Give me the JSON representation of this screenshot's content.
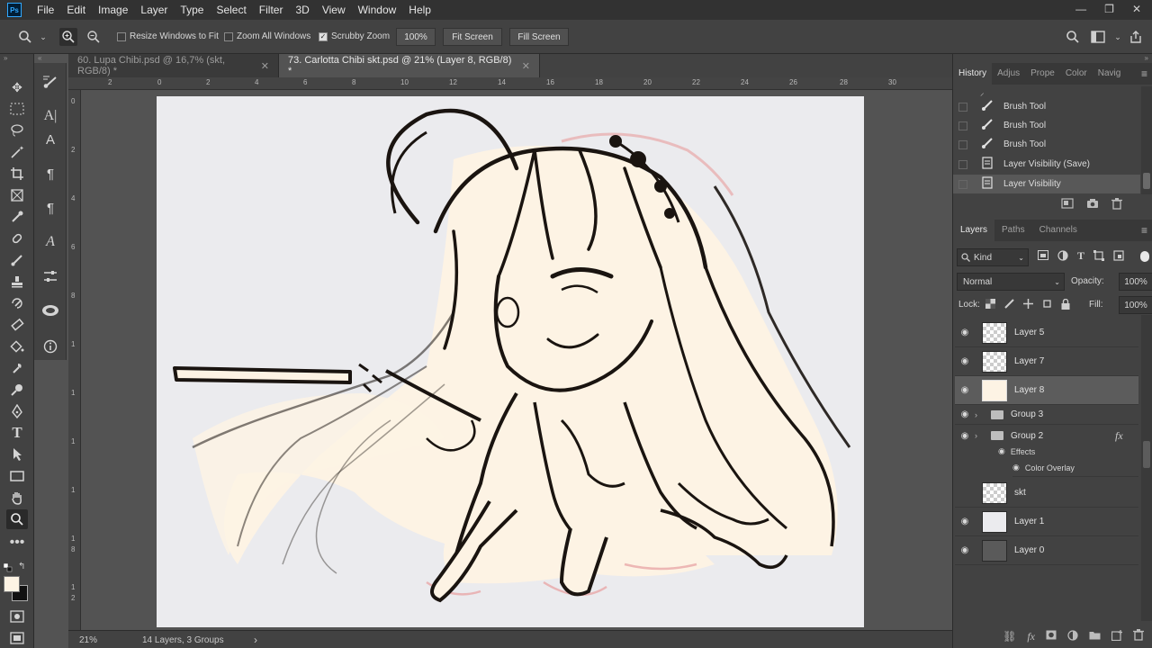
{
  "menubar": {
    "logo": "Ps",
    "items": [
      "File",
      "Edit",
      "Image",
      "Layer",
      "Type",
      "Select",
      "Filter",
      "3D",
      "View",
      "Window",
      "Help"
    ],
    "window_controls": [
      "—",
      "❐",
      "✕"
    ]
  },
  "options": {
    "resize_windows": "Resize Windows to Fit",
    "zoom_all": "Zoom All Windows",
    "scrubby_zoom": "Scrubby Zoom",
    "zoom_value": "100%",
    "fit_screen": "Fit Screen",
    "fill_screen": "Fill Screen"
  },
  "tabs": [
    {
      "label": "60. Lupa Chibi.psd @ 16,7% (skt, RGB/8) *"
    },
    {
      "label": "73. Carlotta Chibi skt.psd @ 21% (Layer 8, RGB/8) *"
    }
  ],
  "ruler_top": [
    "2",
    "0",
    "2",
    "4",
    "6",
    "8",
    "10",
    "12",
    "14",
    "16",
    "18",
    "20",
    "22",
    "24",
    "26",
    "28",
    "30"
  ],
  "ruler_left": [
    "0",
    "2",
    "4",
    "6",
    "8",
    "1",
    "1",
    "1",
    "1",
    "1",
    "8",
    "1",
    "2"
  ],
  "status": {
    "zoom": "21%",
    "info": "14 Layers, 3 Groups"
  },
  "history": {
    "tabs": [
      "History",
      "Adjus",
      "Prope",
      "Color",
      "Navig"
    ],
    "items": [
      {
        "label": "Brush Tool",
        "icon": "brush-icon"
      },
      {
        "label": "Brush Tool",
        "icon": "brush-icon"
      },
      {
        "label": "Brush Tool",
        "icon": "brush-icon"
      },
      {
        "label": "Layer Visibility (Save)",
        "icon": "document-icon"
      },
      {
        "label": "Layer Visibility",
        "icon": "document-icon"
      }
    ]
  },
  "layers_panel": {
    "tabs": [
      "Layers",
      "Paths",
      "Channels"
    ],
    "filter": "Kind",
    "blend_mode": "Normal",
    "opacity_label": "Opacity:",
    "opacity_value": "100%",
    "lock_label": "Lock:",
    "fill_label": "Fill:",
    "fill_value": "100%",
    "effects_label": "Effects",
    "color_overlay_label": "Color Overlay",
    "fx_label": "fx",
    "layers": [
      {
        "name": "Layer 5",
        "visible": true,
        "type": "layer"
      },
      {
        "name": "Layer 7",
        "visible": true,
        "type": "layer"
      },
      {
        "name": "Layer 8",
        "visible": true,
        "type": "layer",
        "selected": true
      },
      {
        "name": "Group 3",
        "visible": true,
        "type": "group"
      },
      {
        "name": "Group 2",
        "visible": true,
        "type": "group"
      },
      {
        "name": "skt",
        "visible": false,
        "type": "layer"
      },
      {
        "name": "Layer 1",
        "visible": true,
        "type": "layer"
      },
      {
        "name": "Layer 0",
        "visible": true,
        "type": "layer"
      }
    ]
  },
  "colors": {
    "canvas_bg": "#ebebee",
    "sketch_fill": "#fdf3e4",
    "line_art": "#1a1410",
    "accent_red": "#e8a8a8"
  }
}
